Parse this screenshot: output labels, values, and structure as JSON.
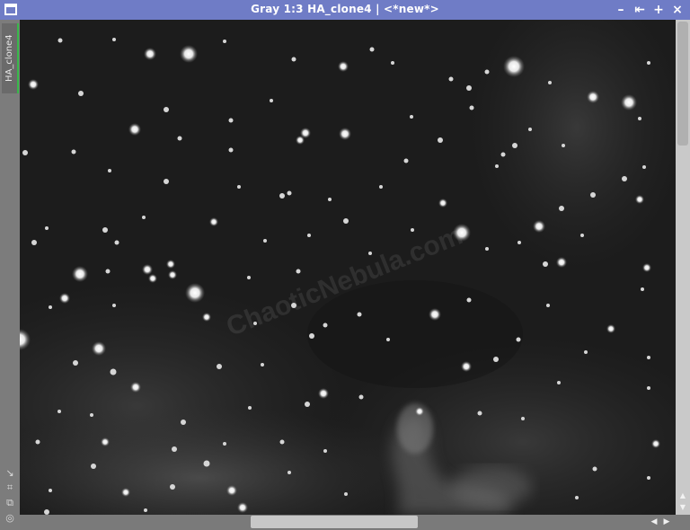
{
  "window": {
    "title": "Gray 1:3 HA_clone4 | <*new*>",
    "controls": {
      "minimize": "–",
      "restore": "⇤",
      "maximize": "+",
      "close": "×"
    }
  },
  "sidebar": {
    "tab_label": "HA_clone4",
    "tools": [
      "↘",
      "⌗",
      "⧉",
      "◎"
    ]
  },
  "image": {
    "watermark": "ChaoticNebula.com",
    "background_color": "#1b1b1b"
  },
  "scrollbars": {
    "vertical_position": 0.0,
    "horizontal_position": 0.35
  },
  "colors": {
    "titlebar": "#6f7cc6",
    "tab_accent": "#38b74a"
  }
}
